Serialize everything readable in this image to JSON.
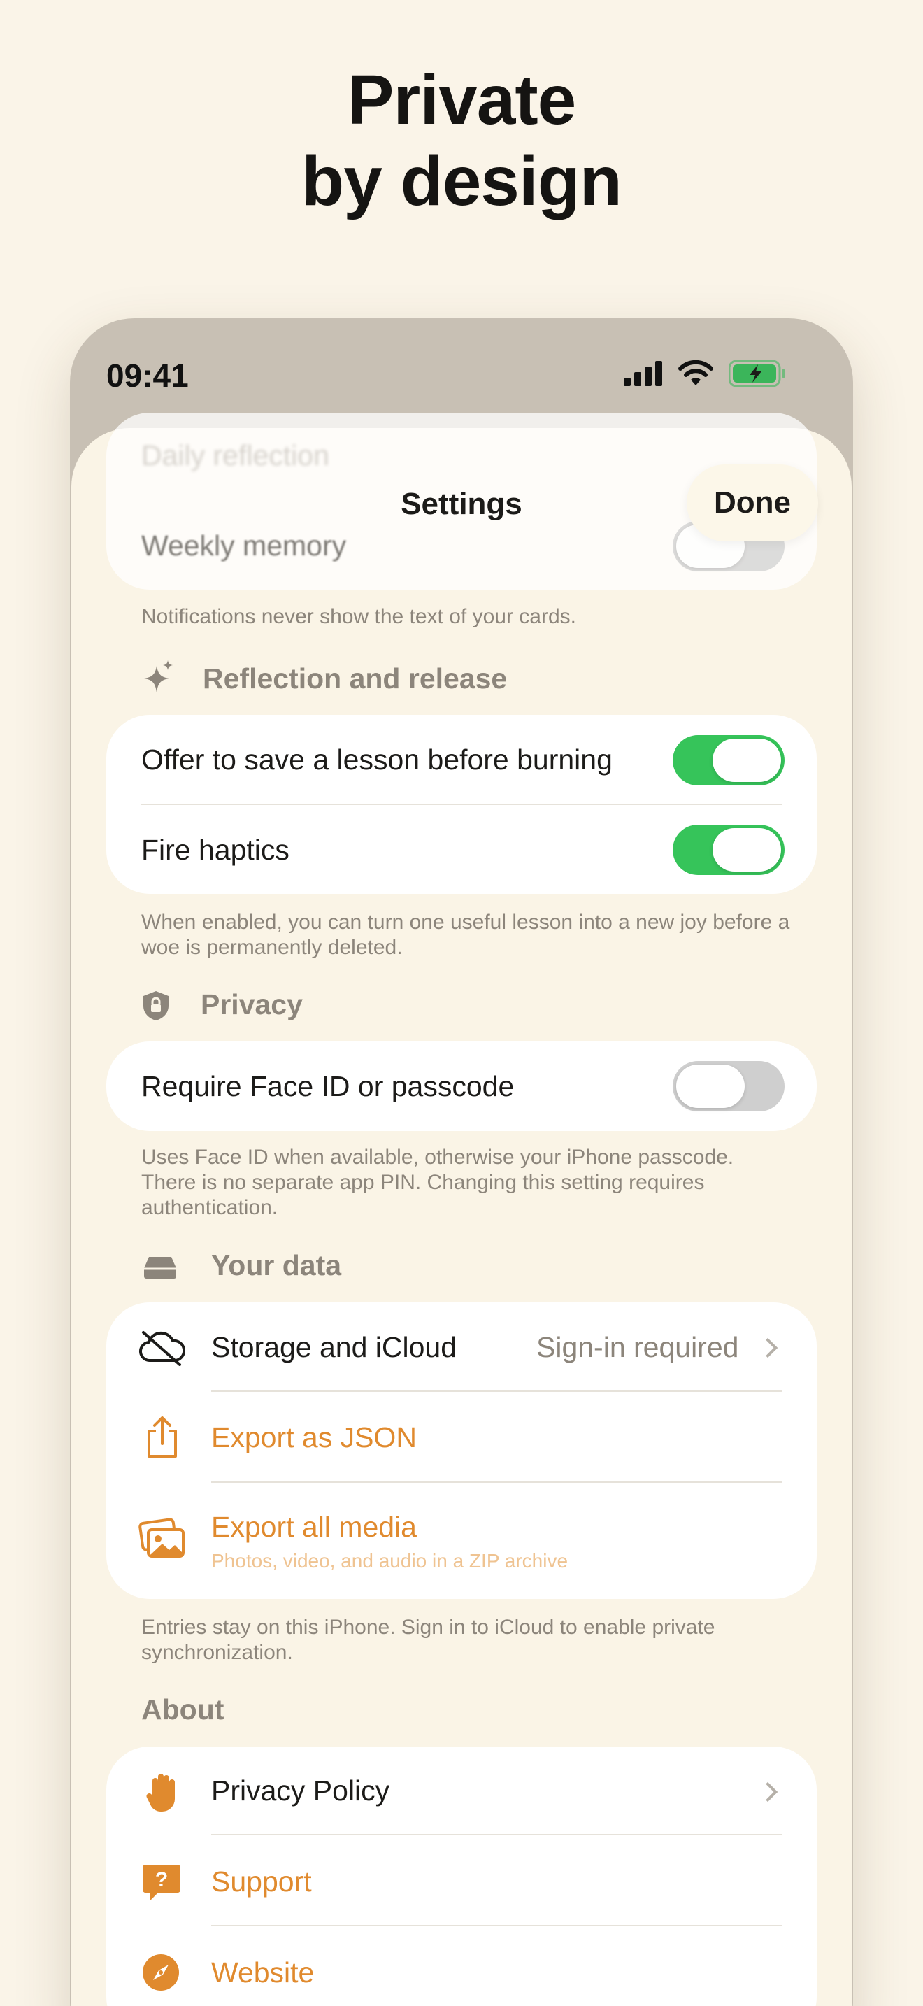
{
  "headline": {
    "line1": "Private",
    "line2": "by design"
  },
  "status_bar": {
    "time": "09:41"
  },
  "sheet": {
    "title": "Settings",
    "done_label": "Done",
    "faded_rows": [
      "Daily reflection",
      "Weekly memory"
    ]
  },
  "notifications": {
    "footnote": "Notifications never show the text of your cards."
  },
  "reflection": {
    "section_title": "Reflection and release",
    "rows": [
      {
        "label": "Offer to save a lesson before burning",
        "toggle": "on"
      },
      {
        "label": "Fire haptics",
        "toggle": "on"
      }
    ],
    "footnote": "When enabled, you can turn one useful lesson into a new joy before a woe is permanently deleted."
  },
  "privacy": {
    "section_title": "Privacy",
    "rows": [
      {
        "label": "Require Face ID or passcode",
        "toggle": "off"
      }
    ],
    "footnote": "Uses Face ID when available, otherwise your iPhone passcode. There is no separate app PIN. Changing this setting requires authentication."
  },
  "data": {
    "section_title": "Your data",
    "storage": {
      "label": "Storage and iCloud",
      "value": "Sign-in required"
    },
    "export_json": {
      "label": "Export as JSON"
    },
    "export_media": {
      "label": "Export all media",
      "sublabel": "Photos, video, and audio in a ZIP archive"
    },
    "footnote": "Entries stay on this iPhone. Sign in to iCloud to enable private synchronization."
  },
  "about": {
    "section_title": "About",
    "privacy_policy": "Privacy Policy",
    "support": "Support",
    "website": "Website"
  },
  "colors": {
    "accent": "#e08a2e",
    "toggle_on": "#36c45a",
    "background": "#faf4e8"
  }
}
